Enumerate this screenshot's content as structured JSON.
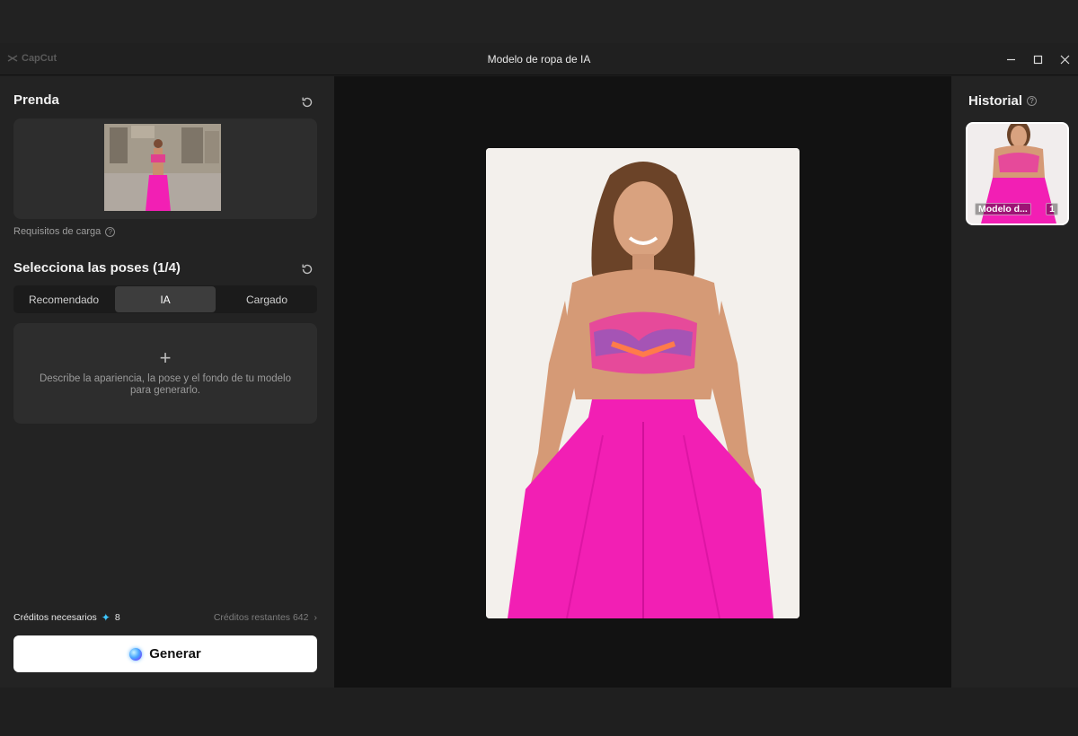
{
  "titlebar": {
    "app_name": "CapCut",
    "window_title": "Modelo de ropa de IA",
    "icons": [
      "capcut-logo-icon",
      "minimize-icon",
      "maximize-icon",
      "close-icon"
    ]
  },
  "left_panel": {
    "garment": {
      "title": "Prenda",
      "upload_requirements": "Requisitos de carga"
    },
    "poses": {
      "title": "Selecciona las poses (1/4)",
      "tabs": [
        {
          "label": "Recomendado",
          "active": false
        },
        {
          "label": "IA",
          "active": true
        },
        {
          "label": "Cargado",
          "active": false
        }
      ],
      "add_symbol": "+",
      "description": "Describe la apariencia, la pose y el fondo de tu modelo para generarlo."
    },
    "credits": {
      "needed_label": "Créditos necesarios",
      "needed_value": "8",
      "remaining_label": "Créditos restantes 642"
    },
    "generate_label": "Generar"
  },
  "history": {
    "title": "Historial",
    "items": [
      {
        "label": "Modelo d...",
        "count": "1"
      }
    ]
  },
  "colors": {
    "accent_magenta": "#f21fb4",
    "spark_blue": "#3ec7ff",
    "panel_bg": "#232323",
    "canvas_bg": "#121212"
  }
}
